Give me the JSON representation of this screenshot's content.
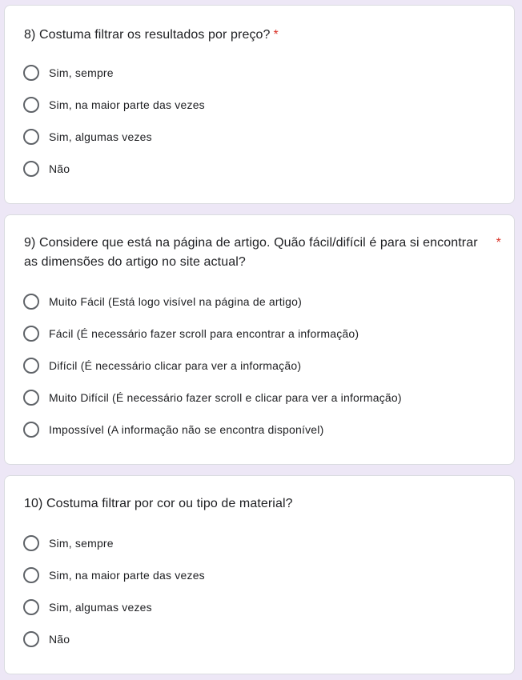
{
  "questions": [
    {
      "title": "8) Costuma filtrar os resultados por preço?",
      "required_mark": "*",
      "options": [
        "Sim, sempre",
        "Sim, na maior parte das vezes",
        "Sim, algumas vezes",
        "Não"
      ]
    },
    {
      "title": "9) Considere que está na página de artigo. Quão fácil/difícil é para si encontrar as dimensões do artigo no site actual?",
      "required_mark": "*",
      "options": [
        "Muito Fácil (Está logo visível na página de artigo)",
        "Fácil (É necessário fazer scroll para encontrar a informação)",
        "Difícil (É necessário clicar para ver a informação)",
        "Muito Difícil (É necessário fazer scroll e clicar para ver a informação)",
        "Impossível (A informação não se encontra disponível)"
      ]
    },
    {
      "title": "10) Costuma filtrar por cor ou tipo de material?",
      "options": [
        "Sim, sempre",
        "Sim, na maior parte das vezes",
        "Sim, algumas vezes",
        "Não"
      ]
    }
  ],
  "colors": {
    "background": "#ede7f6",
    "card": "#ffffff",
    "required": "#d93025",
    "radio_border": "#5f6368",
    "text": "#202124"
  }
}
